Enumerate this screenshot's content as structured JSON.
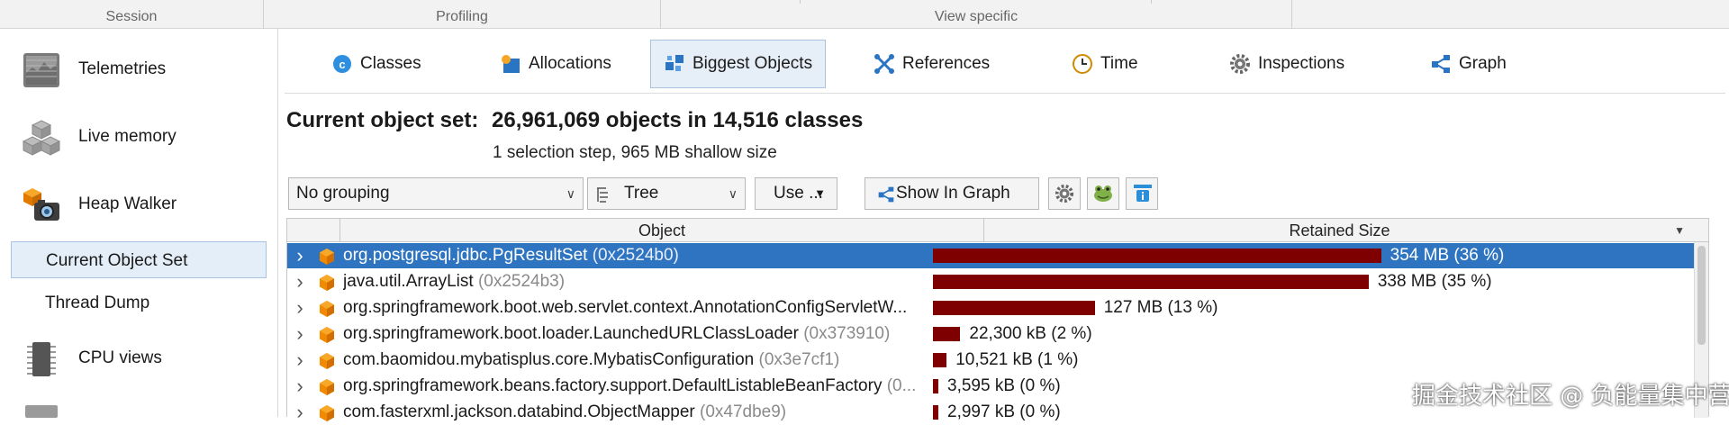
{
  "sections": [
    "Session",
    "Profiling",
    "View specific"
  ],
  "sidebar": {
    "items": [
      {
        "label": "Telemetries",
        "icon": "telemetries-icon"
      },
      {
        "label": "Live memory",
        "icon": "live-memory-icon"
      },
      {
        "label": "Heap Walker",
        "icon": "heap-walker-icon"
      }
    ],
    "sub_items": [
      {
        "label": "Current Object Set",
        "selected": true
      },
      {
        "label": "Thread Dump",
        "selected": false
      }
    ],
    "items_after": [
      {
        "label": "CPU views",
        "icon": "cpu-views-icon"
      }
    ]
  },
  "tabs": [
    {
      "label": "Classes",
      "icon": "classes-icon"
    },
    {
      "label": "Allocations",
      "icon": "allocations-icon"
    },
    {
      "label": "Biggest Objects",
      "icon": "biggest-objects-icon",
      "active": true
    },
    {
      "label": "References",
      "icon": "references-icon"
    },
    {
      "label": "Time",
      "icon": "time-icon"
    },
    {
      "label": "Inspections",
      "icon": "inspections-icon"
    },
    {
      "label": "Graph",
      "icon": "graph-icon"
    }
  ],
  "header": {
    "key": "Current object set:",
    "value": "26,961,069 objects in 14,516 classes",
    "sub": "1 selection step, 965 MB shallow size"
  },
  "toolbar": {
    "grouping_value": "No grouping",
    "view_value": "Tree",
    "use_label": "Use ...",
    "show_in_graph_label": "Show In Graph"
  },
  "table": {
    "columns": [
      "Object",
      "Retained Size"
    ],
    "rows": [
      {
        "name": "org.postgresql.jdbc.PgResultSet",
        "id": "(0x2524b0)",
        "size": "354 MB (36 %)",
        "fraction": 0.36,
        "selected": true
      },
      {
        "name": "java.util.ArrayList",
        "id": "(0x2524b3)",
        "size": "338 MB (35 %)",
        "fraction": 0.35
      },
      {
        "name": "org.springframework.boot.web.servlet.context.AnnotationConfigServletW...",
        "id": "",
        "size": "127 MB (13 %)",
        "fraction": 0.13
      },
      {
        "name": "org.springframework.boot.loader.LaunchedURLClassLoader",
        "id": "(0x373910)",
        "size": "22,300 kB (2 %)",
        "fraction": 0.022
      },
      {
        "name": "com.baomidou.mybatisplus.core.MybatisConfiguration",
        "id": "(0x3e7cf1)",
        "size": "10,521 kB (1 %)",
        "fraction": 0.011
      },
      {
        "name": "org.springframework.beans.factory.support.DefaultListableBeanFactory",
        "id": "(0...",
        "size": "3,595 kB (0 %)",
        "fraction": 0.0037
      },
      {
        "name": "com.fasterxml.jackson.databind.ObjectMapper",
        "id": "(0x47dbe9)",
        "size": "2,997 kB (0 %)",
        "fraction": 0.0031
      }
    ]
  },
  "watermark": "掘金技术社区 @ 负能量集中营",
  "colors": {
    "bar": "#7f0000",
    "selection": "#2e74c0",
    "object_icon": "#f28a00"
  }
}
